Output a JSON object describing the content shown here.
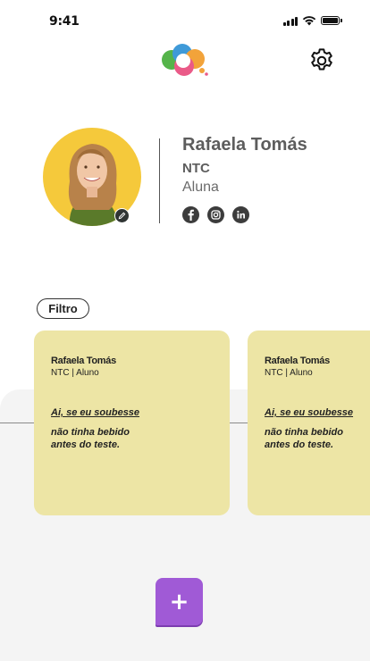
{
  "status_bar": {
    "time": "9:41"
  },
  "header": {
    "logo_icon": "cloud-logo-icon",
    "settings_icon": "gear-icon",
    "logo_colors": [
      "#f2a33a",
      "#ea5a88",
      "#3f9ad8",
      "#55b44a"
    ]
  },
  "profile": {
    "name": "Rafaela Tomás",
    "organization": "NTC",
    "role": "Aluna",
    "edit_icon": "pencil-icon",
    "socials": [
      {
        "icon": "facebook-icon"
      },
      {
        "icon": "instagram-icon"
      },
      {
        "icon": "linkedin-icon"
      }
    ]
  },
  "filter": {
    "label": "Filtro"
  },
  "cards": [
    {
      "author": "Rafaela Tomás",
      "meta": "NTC | Aluno",
      "title": "Ai, se eu soubesse",
      "body": "não tinha bebido antes do teste."
    },
    {
      "author": "Rafaela Tomás",
      "meta": "NTC | Aluno",
      "title": "Ai, se eu soubesse",
      "body": "não tinha bebido antes do teste."
    }
  ],
  "fab": {
    "label": "+",
    "color": "#a05ad6"
  },
  "colors": {
    "card": "#ede5a5",
    "accent": "#a05ad6",
    "background": "#f4f4f4"
  }
}
